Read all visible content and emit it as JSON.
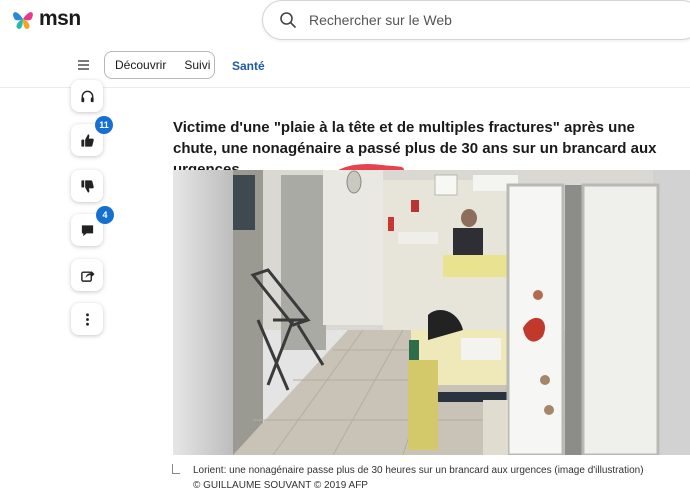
{
  "brand": {
    "name": "msn"
  },
  "search": {
    "placeholder": "Rechercher sur le Web"
  },
  "nav": {
    "pill_items": [
      "Découvrir",
      "Suivi"
    ],
    "active_section": "Santé"
  },
  "rail": {
    "like_count": "11",
    "comment_count": "4"
  },
  "article": {
    "headline": "Victime d'une \"plaie à la tête et de multiples fractures\" après une chute, une nonagénaire a passé plus de 30 ans sur un brancard aux urgences.",
    "caption": "Lorient: une nonagénaire passe plus de 30 heures sur un brancard aux urgences (image d'illustration)",
    "credit": "© GUILLAUME SOUVANT © 2019 AFP"
  },
  "colors": {
    "accent": "#1f5aa8",
    "badge": "#1570d1",
    "annotation": "#e0232e"
  }
}
